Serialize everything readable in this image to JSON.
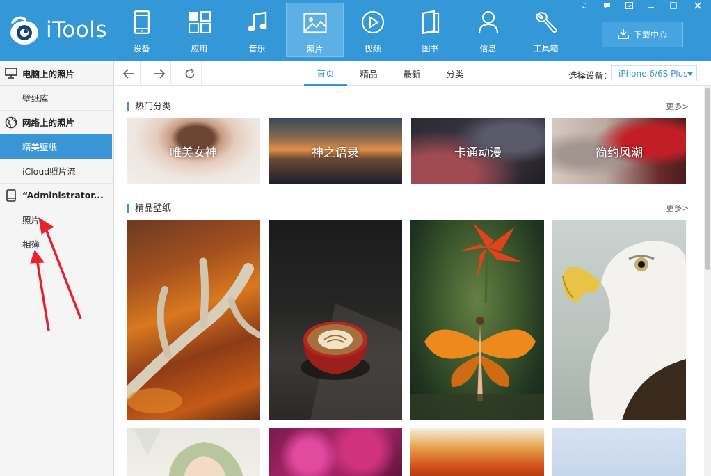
{
  "app": {
    "name": "iTools"
  },
  "nav": [
    {
      "id": "device",
      "label": "设备",
      "icon": "phone-icon"
    },
    {
      "id": "apps",
      "label": "应用",
      "icon": "apps-grid-icon"
    },
    {
      "id": "music",
      "label": "音乐",
      "icon": "music-note-icon"
    },
    {
      "id": "photos",
      "label": "照片",
      "icon": "picture-icon"
    },
    {
      "id": "video",
      "label": "视频",
      "icon": "play-icon"
    },
    {
      "id": "books",
      "label": "图书",
      "icon": "book-icon"
    },
    {
      "id": "messages",
      "label": "信息",
      "icon": "person-icon"
    },
    {
      "id": "tools",
      "label": "工具箱",
      "icon": "wrench-icon"
    }
  ],
  "download_button": {
    "label": "下载中心",
    "icon": "download-icon"
  },
  "sidebar": {
    "sections": [
      {
        "title": "电脑上的照片",
        "icon": "monitor-icon",
        "items": [
          "壁纸库"
        ]
      },
      {
        "title": "网络上的照片",
        "icon": "globe-icon",
        "items": [
          "精美壁纸",
          "iCloud照片流"
        ],
        "active": "精美壁纸"
      },
      {
        "title": "“Administrator...",
        "icon": "device-icon",
        "items": [
          "照片",
          "相簿"
        ]
      }
    ]
  },
  "toolbar": {
    "tabs": [
      "首页",
      "精品",
      "最新",
      "分类"
    ],
    "active_tab": "首页",
    "device_label": "选择设备：",
    "device_value": "iPhone 6/6S Plus"
  },
  "main": {
    "hot_title": "热门分类",
    "more": "更多>",
    "categories": [
      "唯美女神",
      "神之语录",
      "卡通动漫",
      "简约风潮"
    ],
    "wallpaper_title": "精品壁纸",
    "wallpapers": [
      "antler-on-orange-wood",
      "latte-cup",
      "butterfly-woman-and-lily",
      "bald-eagle"
    ],
    "wallpapers_row2": [
      "anime-girl",
      "pink-flowers",
      "autumn-forest",
      "light-blue"
    ]
  },
  "colors": {
    "topbar": "#3397d8",
    "accent": "#3a95d6",
    "annotation": "#e8212b"
  }
}
